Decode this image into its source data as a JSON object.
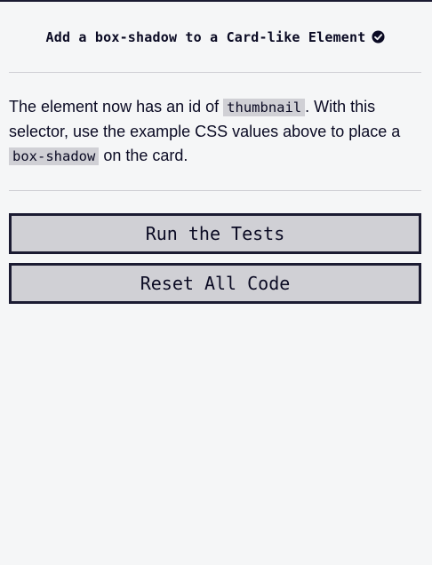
{
  "challenge": {
    "title": "Add a box-shadow to a Card-like Element",
    "completed_icon": "check-circle-icon"
  },
  "description": {
    "part1": "The element now has an id of ",
    "code1": "thumbnail",
    "part2": ". With this selector, use the example CSS values above to place a ",
    "code2": "box-shadow",
    "part3": " on the card."
  },
  "buttons": {
    "run_tests": "Run the Tests",
    "reset_code": "Reset All Code"
  },
  "colors": {
    "background": "#f5f6f7",
    "text": "#0a0a23",
    "button_bg": "#d0d0d5",
    "border": "#1b1b32"
  }
}
